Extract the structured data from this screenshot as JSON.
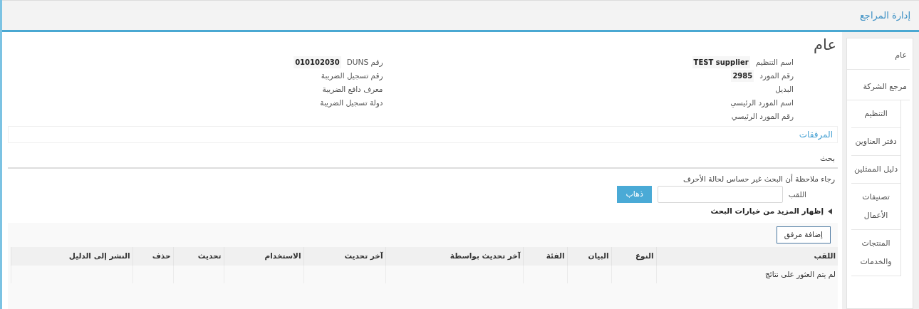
{
  "header": {
    "title": "إدارة المراجع"
  },
  "sidebar": {
    "items": [
      {
        "label": "عام",
        "selected": false
      },
      {
        "label": "مرجع الشركة",
        "selected": false,
        "children": [
          {
            "label": "التنظيم",
            "selected": false
          },
          {
            "label": "دفتر العناوين",
            "selected": false
          },
          {
            "label": "دليل الممثلين",
            "selected": false
          },
          {
            "label": "تصنيفات الأعمال",
            "selected": false
          },
          {
            "label": "المنتجات والخدمات",
            "selected": false
          }
        ]
      }
    ]
  },
  "heading": "عام",
  "fields_right": [
    {
      "label": "اسم التنظيم",
      "value": "TEST supplier"
    },
    {
      "label": "رقم المورد",
      "value": "2985"
    },
    {
      "label": "البديل"
    },
    {
      "label": "اسم المورد الرئيسي"
    },
    {
      "label": "رقم المورد الرئيسي"
    }
  ],
  "fields_left": [
    {
      "label": "رقم DUNS",
      "value": "010102030"
    },
    {
      "label": "رقم تسجيل الضريبة"
    },
    {
      "label": "معرف دافع الضريبة"
    },
    {
      "label": "دولة تسجيل الضريبة"
    }
  ],
  "attachments": {
    "title": "المرفقات",
    "search_title": "بحث",
    "note": "رجاء ملاحظة أن البحث غير حساس لحالة الأحرف",
    "search_label": "اللقب",
    "go_button": "ذهاب",
    "more_options": "إظهار المزيد من خيارات البحث",
    "add_button": "إضافة مرفق",
    "columns": [
      "اللقب",
      "النوع",
      "البيان",
      "الفئة",
      "آخر تحديث بواسطة",
      "آخر تحديث",
      "الاستخدام",
      "تحديث",
      "حذف",
      "النشر إلى الدليل"
    ],
    "empty_message": "لم يتم العثور على نتائج"
  }
}
